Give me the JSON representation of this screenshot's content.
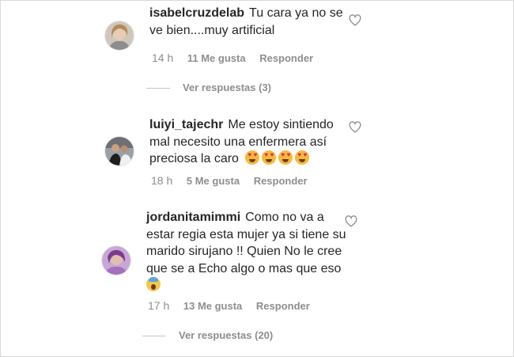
{
  "comments": [
    {
      "username": "isabelcruzdelab",
      "line1": "Tu cara ya no se",
      "line2": "ve bien....muy artificial",
      "time": "14 h",
      "likes": "11 Me gusta",
      "reply": "Responder",
      "replies": "Ver respuestas (3)"
    },
    {
      "username": "luiyi_tajechr",
      "line1": "Me estoy sintiendo",
      "line2": "mal necesito una enfermera así",
      "line3": "preciosa la caro",
      "emoji": "heart-eyes-emoji",
      "time": "18 h",
      "likes": "5 Me gusta",
      "reply": "Responder"
    },
    {
      "username": "jordanitamimmi",
      "line1": "Como no va a",
      "line2": "estar regia esta mujer ya si tiene su",
      "line3": "marido sirujano !! Quien No le cree",
      "line4": "que se a Echo algo o mas que eso",
      "emoji": "scream-emoji",
      "time": "17 h",
      "likes": "13 Me gusta",
      "reply": "Responder",
      "replies": "Ver respuestas (20)"
    }
  ],
  "colors": {
    "text": "#262626",
    "meta": "#8e8e8e",
    "border": "#d9d9d9"
  },
  "icons": {
    "like": "heart-outline-icon"
  }
}
